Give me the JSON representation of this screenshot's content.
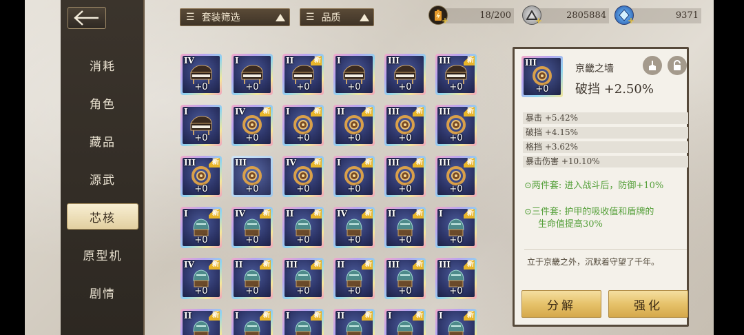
{
  "sidebar": {
    "items": [
      {
        "label": "消耗"
      },
      {
        "label": "角色"
      },
      {
        "label": "藏品"
      },
      {
        "label": "源武"
      },
      {
        "label": "芯核"
      },
      {
        "label": "原型机"
      },
      {
        "label": "剧情"
      }
    ],
    "active_index": 4
  },
  "filters": {
    "set_filter": "套装筛选",
    "quality": "品质"
  },
  "currencies": {
    "stamina": "18/200",
    "coins": "2805884",
    "crystals": "9371"
  },
  "grid": {
    "rows": [
      [
        {
          "tier": "IV",
          "new": false,
          "art": "piano"
        },
        {
          "tier": "I",
          "new": false,
          "art": "piano"
        },
        {
          "tier": "II",
          "new": true,
          "art": "piano"
        },
        {
          "tier": "I",
          "new": false,
          "art": "piano"
        },
        {
          "tier": "III",
          "new": false,
          "art": "piano"
        },
        {
          "tier": "III",
          "new": true,
          "art": "piano"
        }
      ],
      [
        {
          "tier": "I",
          "new": false,
          "art": "piano"
        },
        {
          "tier": "IV",
          "new": true,
          "art": "ring"
        },
        {
          "tier": "I",
          "new": true,
          "art": "ring"
        },
        {
          "tier": "II",
          "new": true,
          "art": "ring"
        },
        {
          "tier": "III",
          "new": true,
          "art": "ring"
        },
        {
          "tier": "III",
          "new": true,
          "art": "ring"
        }
      ],
      [
        {
          "tier": "III",
          "new": true,
          "art": "ring"
        },
        {
          "tier": "III",
          "new": false,
          "art": "ring"
        },
        {
          "tier": "IV",
          "new": true,
          "art": "ring"
        },
        {
          "tier": "I",
          "new": true,
          "art": "ring"
        },
        {
          "tier": "III",
          "new": true,
          "art": "ring"
        },
        {
          "tier": "III",
          "new": true,
          "art": "ring"
        }
      ],
      [
        {
          "tier": "I",
          "new": true,
          "art": "helmet"
        },
        {
          "tier": "IV",
          "new": true,
          "art": "helmet"
        },
        {
          "tier": "II",
          "new": true,
          "art": "helmet"
        },
        {
          "tier": "IV",
          "new": true,
          "art": "helmet"
        },
        {
          "tier": "II",
          "new": true,
          "art": "helmet"
        },
        {
          "tier": "I",
          "new": true,
          "art": "helmet"
        }
      ],
      [
        {
          "tier": "IV",
          "new": true,
          "art": "helmet"
        },
        {
          "tier": "II",
          "new": true,
          "art": "helmet"
        },
        {
          "tier": "III",
          "new": true,
          "art": "helmet"
        },
        {
          "tier": "II",
          "new": true,
          "art": "helmet"
        },
        {
          "tier": "III",
          "new": true,
          "art": "helmet"
        },
        {
          "tier": "III",
          "new": true,
          "art": "helmet"
        }
      ],
      [
        {
          "tier": "II",
          "new": true,
          "art": "helmet"
        },
        {
          "tier": "I",
          "new": true,
          "art": "helmet"
        },
        {
          "tier": "I",
          "new": true,
          "art": "helmet"
        },
        {
          "tier": "II",
          "new": true,
          "art": "helmet"
        },
        {
          "tier": "I",
          "new": true,
          "art": "helmet"
        },
        {
          "tier": "I",
          "new": true,
          "art": "helmet"
        }
      ]
    ],
    "level_label": "+0",
    "new_label": "新",
    "selected": [
      2,
      1
    ]
  },
  "detail": {
    "tier": "III",
    "level": "+0",
    "name": "京畿之墙",
    "main_stat": "破挡  +2.50%",
    "stats": [
      "暴击 +5.42%",
      "破挡 +4.15%",
      "格挡 +3.62%",
      "暴击伤害 +10.10%"
    ],
    "set2": "两件套:   进入战斗后，防御+10%",
    "set3_line1": "三件套:   护甲的吸收值和盾牌的",
    "set3_line2": "生命值提高30%",
    "flavor": "立于京畿之外，沉默着守望了千年。",
    "btn_dismantle": "分解",
    "btn_enhance": "强化"
  }
}
